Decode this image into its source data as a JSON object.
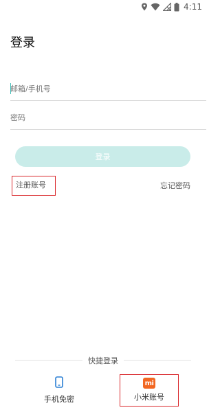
{
  "status_bar": {
    "time": "4:11",
    "icons": [
      "location-icon",
      "wifi-icon",
      "signal-icon",
      "battery-icon"
    ]
  },
  "page": {
    "title": "登录"
  },
  "form": {
    "account_placeholder": "邮箱/手机号",
    "account_value": "",
    "password_placeholder": "密码",
    "password_value": "",
    "login_label": "登录"
  },
  "links": {
    "register": "注册账号",
    "forgot_password": "忘记密码"
  },
  "quick_login": {
    "title": "快捷登录",
    "options": [
      {
        "label": "手机免密",
        "icon": "phone-icon"
      },
      {
        "label": "小米账号",
        "icon": "mi-logo-icon",
        "icon_text": "mi"
      }
    ]
  },
  "colors": {
    "accent": "#3dbcb6",
    "login_button_bg": "#c9ece9",
    "phone_icon": "#2a7fd4",
    "mi_brand": "#f26722",
    "highlight_box": "#d9262a"
  }
}
